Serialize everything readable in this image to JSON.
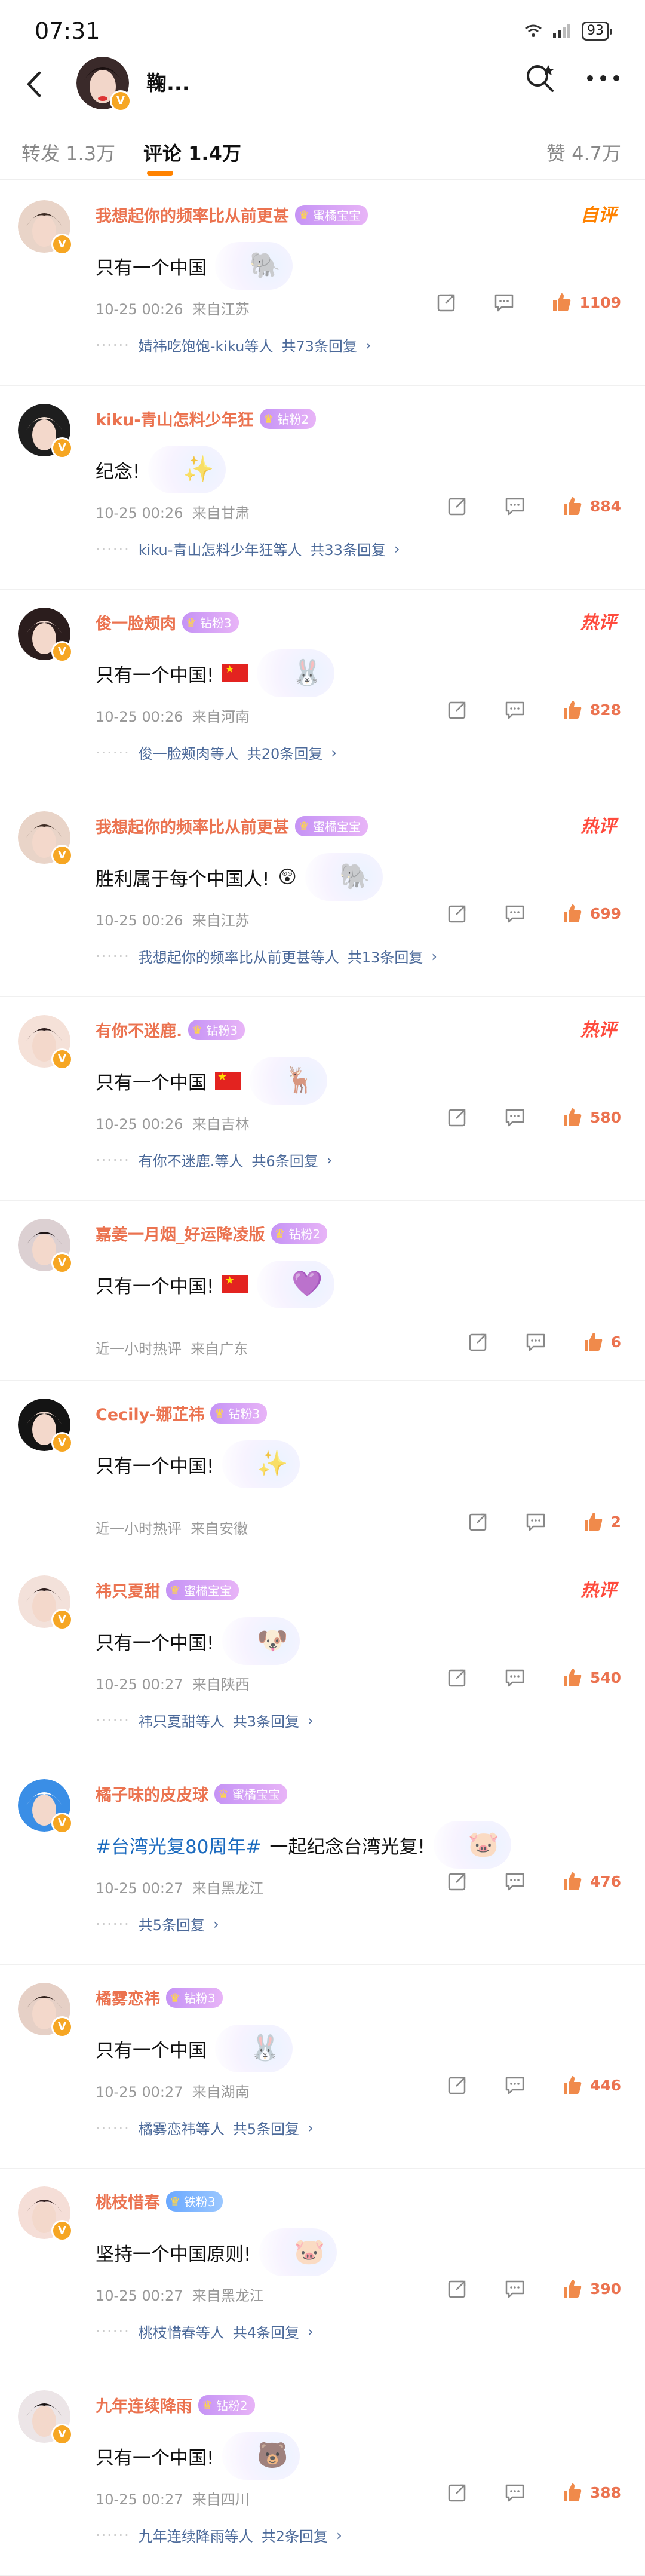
{
  "status": {
    "time": "07:31",
    "battery": "93"
  },
  "header": {
    "title": "鞠..."
  },
  "tabs": [
    {
      "label": "转发",
      "count": "1.3万"
    },
    {
      "label": "评论",
      "count": "1.4万"
    },
    {
      "label": "赞",
      "count": "4.7万"
    }
  ],
  "comments": [
    {
      "user": "我想起你的频率比从前更甚",
      "badge": "蜜橘宝宝",
      "tag": "自评",
      "text": "只有一个中国",
      "time": "10-25 00:26",
      "location": "来自江苏",
      "likes": "1109",
      "reply_users": "婧祎吃饱饱-kiku等人",
      "reply_count": "共73条回复"
    },
    {
      "user": "kiku-青山怎料少年狂",
      "badge": "钻粉2",
      "tag": "",
      "text": "纪念!",
      "time": "10-25 00:26",
      "location": "来自甘肃",
      "likes": "884",
      "reply_users": "kiku-青山怎料少年狂等人",
      "reply_count": "共33条回复"
    },
    {
      "user": "俊一脸颊肉",
      "badge": "钻粉3",
      "tag": "热评",
      "text": "只有一个中国!",
      "time": "10-25 00:26",
      "location": "来自河南",
      "likes": "828",
      "reply_users": "俊一脸颊肉等人",
      "reply_count": "共20条回复"
    },
    {
      "user": "我想起你的频率比从前更甚",
      "badge": "蜜橘宝宝",
      "tag": "热评",
      "text": "胜利属于每个中国人!",
      "time": "10-25 00:26",
      "location": "来自江苏",
      "likes": "699",
      "reply_users": "我想起你的频率比从前更甚等人",
      "reply_count": "共13条回复"
    },
    {
      "user": "有你不迷鹿.",
      "badge": "钻粉3",
      "tag": "热评",
      "text": "只有一个中国",
      "time": "10-25 00:26",
      "location": "来自吉林",
      "likes": "580",
      "reply_users": "有你不迷鹿.等人",
      "reply_count": "共6条回复"
    },
    {
      "user": "嘉姜一月烟_好运降凌版",
      "badge": "钻粉2",
      "tag": "",
      "text": "只有一个中国!",
      "time": "近一小时热评",
      "location": "来自广东",
      "likes": "6",
      "reply_users": "",
      "reply_count": ""
    },
    {
      "user": "Cecily-娜芷祎",
      "badge": "钻粉3",
      "tag": "",
      "text": "只有一个中国!",
      "time": "近一小时热评",
      "location": "来自安徽",
      "likes": "2",
      "reply_users": "",
      "reply_count": ""
    },
    {
      "user": "祎只夏甜",
      "badge": "蜜橘宝宝",
      "tag": "热评",
      "text": "只有一个中国!",
      "time": "10-25 00:27",
      "location": "来自陕西",
      "likes": "540",
      "reply_users": "祎只夏甜等人",
      "reply_count": "共3条回复"
    },
    {
      "user": "橘子味的皮皮球",
      "badge": "蜜橘宝宝",
      "tag": "",
      "topic": "#台湾光复80周年#",
      "text": "一起纪念台湾光复!",
      "time": "10-25 00:27",
      "location": "来自黑龙江",
      "likes": "476",
      "reply_users": "",
      "reply_count": "共5条回复"
    },
    {
      "user": "橘雾恋祎",
      "badge": "钻粉3",
      "tag": "",
      "text": "只有一个中国",
      "time": "10-25 00:27",
      "location": "来自湖南",
      "likes": "446",
      "reply_users": "橘雾恋祎等人",
      "reply_count": "共5条回复"
    },
    {
      "user": "桃枝惜春",
      "badge": "铁粉3",
      "tag": "",
      "text": "坚持一个中国原则!",
      "time": "10-25 00:27",
      "location": "来自黑龙江",
      "likes": "390",
      "reply_users": "桃枝惜春等人",
      "reply_count": "共4条回复"
    },
    {
      "user": "九年连续降雨",
      "badge": "钻粉2",
      "tag": "",
      "text": "只有一个中国!",
      "time": "10-25 00:27",
      "location": "来自四川",
      "likes": "388",
      "reply_users": "九年连续降雨等人",
      "reply_count": "共2条回复"
    }
  ]
}
